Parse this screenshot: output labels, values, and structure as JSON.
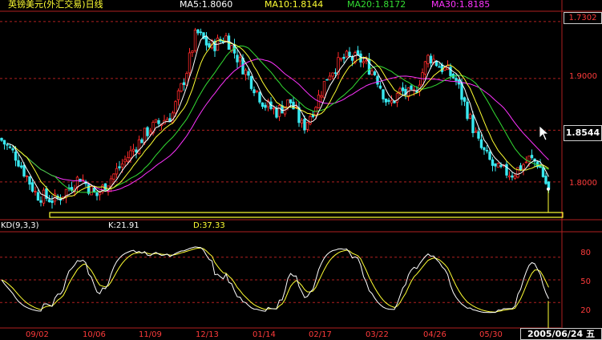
{
  "header": {
    "title": "英镑美元(外汇交易)日线",
    "ma5": "MA5:1.8060",
    "ma10": "MA10:1.8144",
    "ma20": "MA20:1.8172",
    "ma30": "MA30:1.8185"
  },
  "kd_header": {
    "label": "KD(9,3,3)",
    "k": "K:21.91",
    "d": "D:37.33"
  },
  "price_axis": {
    "top_label": "1.7302",
    "current": "1.8544",
    "ticks": [
      "1.9000",
      "1.8000"
    ]
  },
  "kd_axis": {
    "ticks": [
      "80",
      "50",
      "20"
    ]
  },
  "date_axis": {
    "labels": [
      "09/02",
      "10/06",
      "11/09",
      "12/13",
      "01/14",
      "02/17",
      "03/22",
      "04/26",
      "05/30"
    ],
    "current_date": "2005/06/24 五"
  },
  "colors": {
    "up": "#ff2a2a",
    "down": "#38e8f0",
    "ma5": "#ffffff",
    "ma10": "#ffff33",
    "ma20": "#33dd33",
    "ma30": "#ff33ff",
    "grid": "#b02020",
    "k": "#ffffff",
    "d": "#ffff33"
  },
  "chart_data": {
    "type": "line",
    "title": "英镑美元(外汇交易)日线",
    "xlabel": "",
    "ylabel": "",
    "ylim": [
      1.765,
      1.965
    ],
    "x": [
      "09/02",
      "10/06",
      "11/09",
      "12/13",
      "01/14",
      "02/17",
      "03/22",
      "04/26",
      "05/30"
    ],
    "series": [
      {
        "name": "MA5",
        "values": [
          1.79,
          1.795,
          1.845,
          1.935,
          1.86,
          1.88,
          1.91,
          1.905,
          1.815
        ]
      },
      {
        "name": "MA10",
        "values": [
          1.795,
          1.79,
          1.84,
          1.925,
          1.865,
          1.875,
          1.905,
          1.91,
          1.82
        ]
      },
      {
        "name": "MA20",
        "values": [
          1.8,
          1.79,
          1.83,
          1.915,
          1.87,
          1.87,
          1.9,
          1.91,
          1.825
        ]
      },
      {
        "name": "MA30",
        "values": [
          1.805,
          1.79,
          1.82,
          1.905,
          1.875,
          1.865,
          1.895,
          1.91,
          1.83
        ]
      }
    ],
    "last": {
      "ma5": 1.806,
      "ma10": 1.8144,
      "ma20": 1.8172,
      "ma30": 1.8185
    },
    "kd": {
      "name": "KD(9,3,3)",
      "k": 21.91,
      "d": 37.33,
      "levels": [
        80,
        50,
        20
      ]
    }
  }
}
